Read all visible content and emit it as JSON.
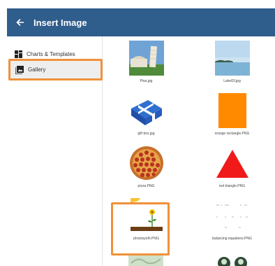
{
  "header": {
    "title": "Insert Image",
    "back_icon": "arrow-left-icon",
    "bg_color": "#2f5d8c"
  },
  "sidebar": {
    "items": [
      {
        "label": "Charts & Templates",
        "icon": "charts-templates-icon"
      },
      {
        "label": "Gallery",
        "icon": "gallery-icon",
        "selected": true
      }
    ]
  },
  "gallery": {
    "images": [
      {
        "caption": "Pisa.jpg"
      },
      {
        "caption": "Lake03.jpg"
      },
      {
        "caption": "gift box.jpg"
      },
      {
        "caption": "orange rectangle.PNG"
      },
      {
        "caption": "pizza.PNG"
      },
      {
        "caption": "red triangle.PNG"
      },
      {
        "caption": "photosynth.PNG"
      },
      {
        "caption": "balancing equations.PNG",
        "highlighted": true
      }
    ]
  },
  "highlight_color": "#f0913a"
}
